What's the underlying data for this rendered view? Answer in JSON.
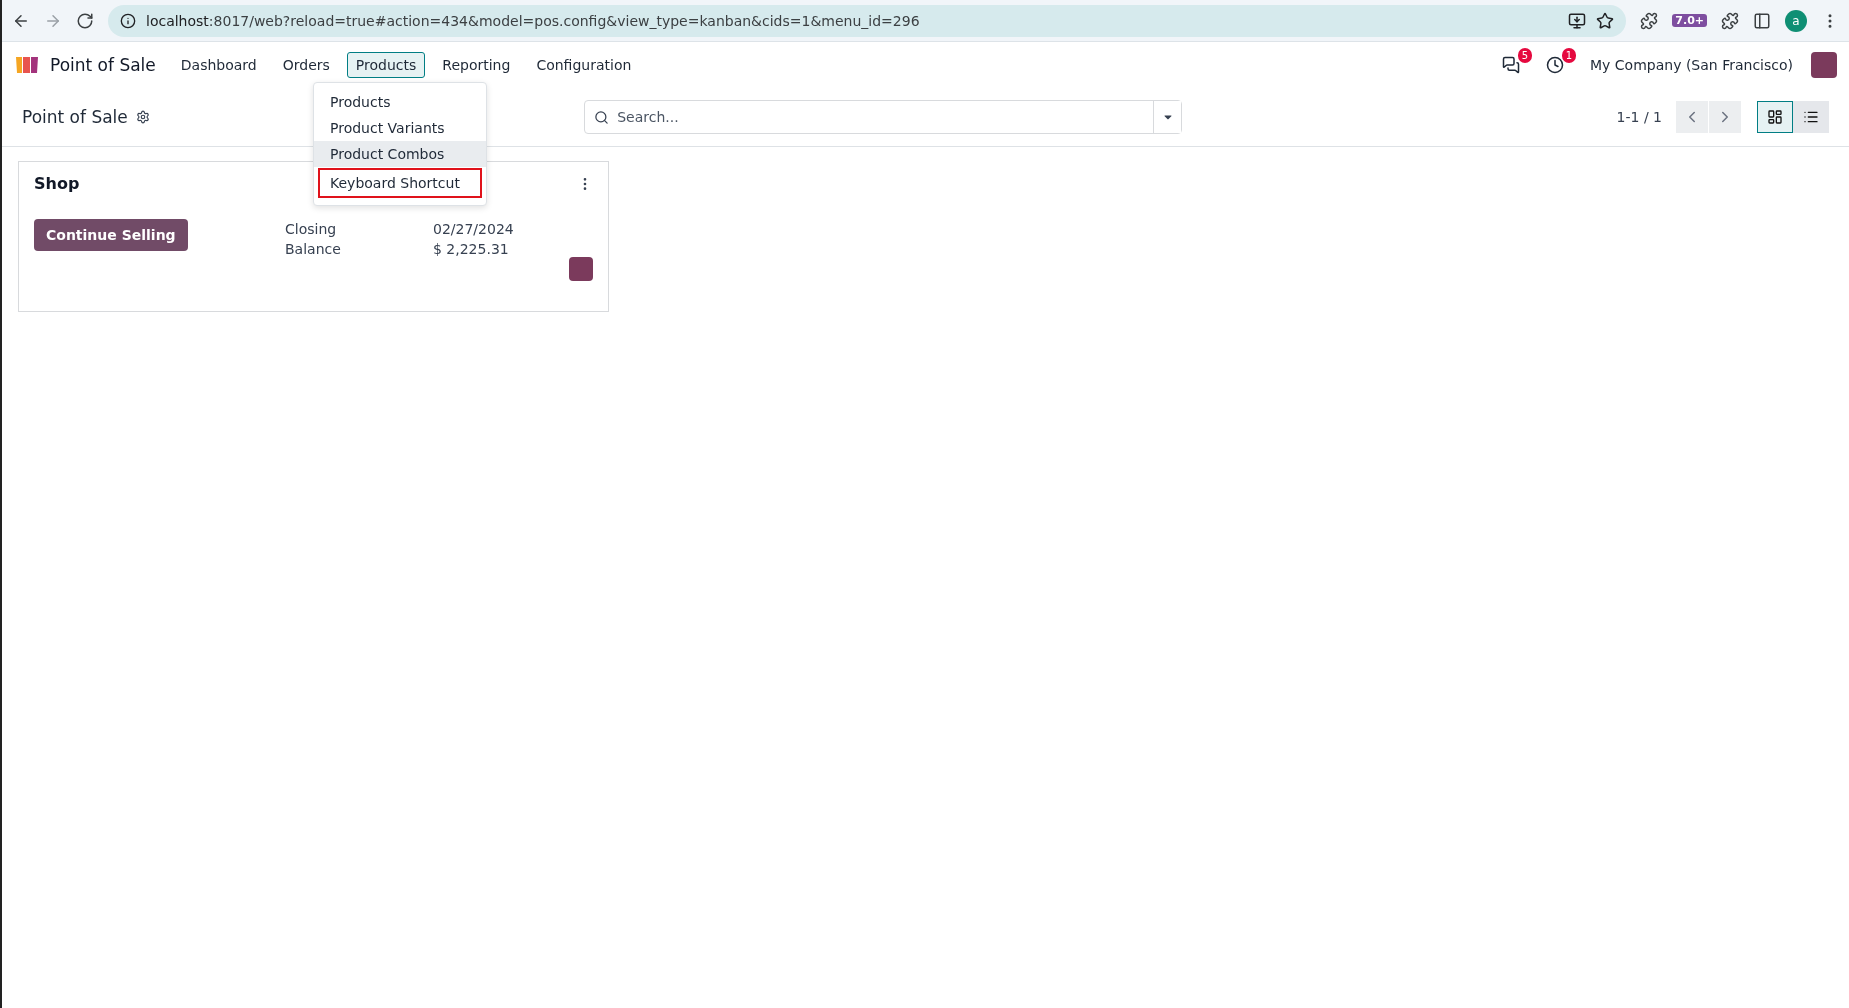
{
  "browser": {
    "url_host": "localhost",
    "url_rest": ":8017/web?reload=true#action=434&model=pos.config&view_type=kanban&cids=1&menu_id=296",
    "extension_badge": "7.0+",
    "profile": "a"
  },
  "navbar": {
    "app_name": "Point of Sale",
    "menus": [
      {
        "label": "Dashboard",
        "selected": false
      },
      {
        "label": "Orders",
        "selected": false
      },
      {
        "label": "Products",
        "selected": true
      },
      {
        "label": "Reporting",
        "selected": false
      },
      {
        "label": "Configuration",
        "selected": false
      }
    ],
    "messages_count": "5",
    "activities_count": "1",
    "company": "My Company (San Francisco)"
  },
  "dropdown": {
    "items": [
      {
        "label": "Products",
        "hovered": false,
        "outlined": false
      },
      {
        "label": "Product Variants",
        "hovered": false,
        "outlined": false
      },
      {
        "label": "Product Combos",
        "hovered": true,
        "outlined": false
      },
      {
        "label": "Keyboard Shortcut",
        "hovered": false,
        "outlined": true
      }
    ]
  },
  "control_panel": {
    "title": "Point of Sale",
    "search": {
      "placeholder": "Search..."
    },
    "pager": "1-1 / 1",
    "views": [
      {
        "kind": "kanban",
        "selected": true
      },
      {
        "kind": "list",
        "selected": false
      }
    ]
  },
  "cards": [
    {
      "name": "Shop",
      "button": "Continue Selling",
      "fields": [
        {
          "label": "Closing",
          "value": "02/27/2024"
        },
        {
          "label": "Balance",
          "value": "$ 2,225.31"
        }
      ]
    }
  ]
}
